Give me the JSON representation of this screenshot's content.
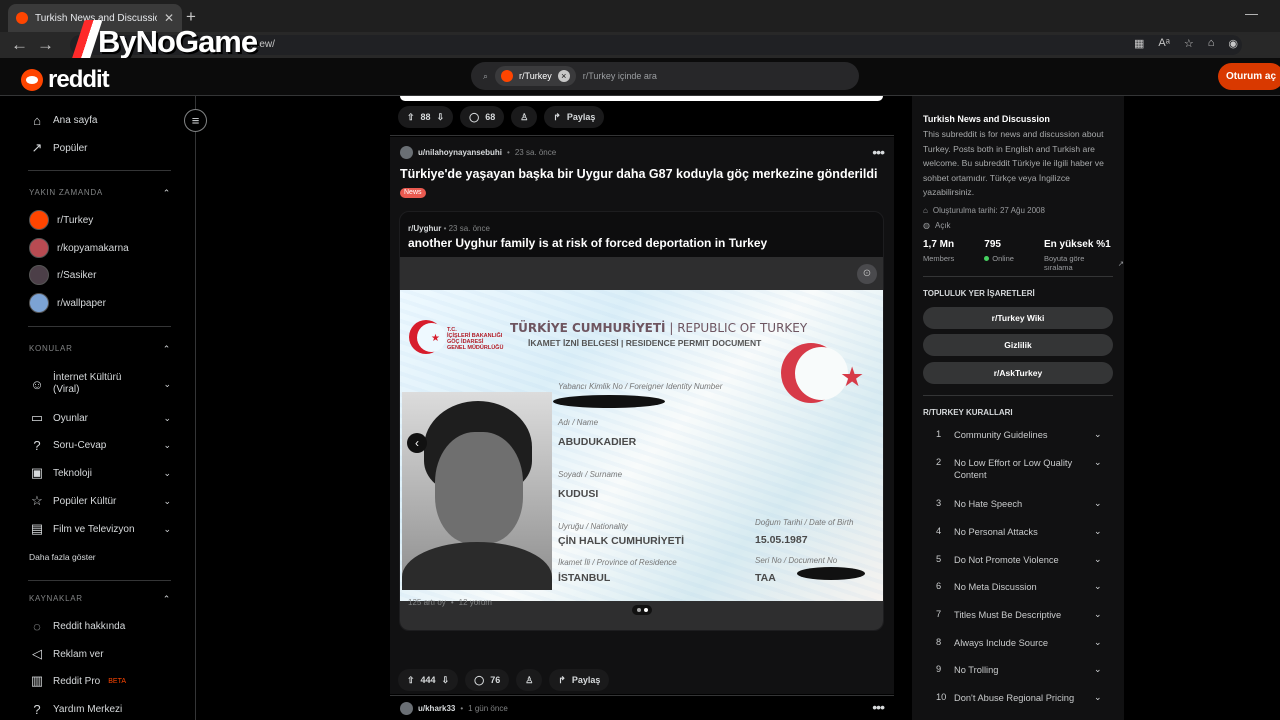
{
  "browser": {
    "tab_title": "Turkish News and Discussion",
    "address_text": "/new/",
    "watermark": "ByNoGame"
  },
  "header": {
    "logo_text": "reddit",
    "search_chip": "r/Turkey",
    "search_placeholder": "r/Turkey içinde ara",
    "login_label": "Oturum aç"
  },
  "sidebar": {
    "nav": [
      {
        "label": "Ana sayfa",
        "icon": "home-icon"
      },
      {
        "label": "Popüler",
        "icon": "popular-icon"
      }
    ],
    "recent_title": "YAKIN ZAMANDA",
    "recent": [
      {
        "label": "r/Turkey",
        "color": "#ff4500"
      },
      {
        "label": "r/kopyamakarna",
        "color": "#b84b52"
      },
      {
        "label": "r/Sasiker",
        "color": "#4c3f48"
      },
      {
        "label": "r/wallpaper",
        "color": "#7ca3d4"
      }
    ],
    "topics_title": "KONULAR",
    "topics": [
      {
        "label": "İnternet Kültürü (Viral)",
        "icon": "smile-icon"
      },
      {
        "label": "Oyunlar",
        "icon": "gamepad-icon"
      },
      {
        "label": "Soru-Cevap",
        "icon": "question-icon"
      },
      {
        "label": "Teknoloji",
        "icon": "chip-icon"
      },
      {
        "label": "Popüler Kültür",
        "icon": "star-icon"
      },
      {
        "label": "Film ve Televizyon",
        "icon": "film-icon"
      }
    ],
    "show_more": "Daha fazla göster",
    "resources_title": "KAYNAKLAR",
    "resources": [
      {
        "label": "Reddit hakkında",
        "icon": "reddit-icon"
      },
      {
        "label": "Reklam ver",
        "icon": "megaphone-icon"
      },
      {
        "label": "Reddit Pro",
        "icon": "chart-icon",
        "badge": "BETA"
      },
      {
        "label": "Yardım Merkezi",
        "icon": "help-icon"
      }
    ]
  },
  "feed": {
    "top_actions": {
      "upvotes": "88",
      "comments": "68",
      "share": "Paylaş"
    },
    "post": {
      "author": "u/nilahoynayansebuhi",
      "time": "23 sa. önce",
      "title": "Türkiye'de yaşayan başka bir Uygur daha G87 koduyla göç merkezine gönderildi",
      "flair": "News",
      "crosspost": {
        "subreddit": "r/Uyghur",
        "time": "23 sa. önce",
        "title": "another Uyghur family is at risk of forced deportation in Turkey",
        "stats_points": "125 artı oy",
        "stats_comments": "12 yorum",
        "document": {
          "ministry": [
            "T.C.",
            "İÇİŞLERİ BAKANLIĞI",
            "GÖÇ İDARESİ",
            "GENEL MÜDÜRLÜĞÜ"
          ],
          "heading_tr": "TÜRKİYE CUMHURİYETİ",
          "heading_en": "REPUBLIC OF TURKEY",
          "subheading": "İKAMET İZNİ BELGESİ | RESIDENCE PERMIT DOCUMENT",
          "fields": {
            "foreign_id_label": "Yabancı Kimlik No / Foreigner Identity Number",
            "name_label": "Adı / Name",
            "name": "ABUDUKADIER",
            "surname_label": "Soyadı / Surname",
            "surname": "KUDUSI",
            "nationality_label": "Uyruğu / Nationality",
            "nationality": "ÇİN HALK CUMHURİYETİ",
            "residence_label": "İkamet İli / Province of Residence",
            "residence": "İSTANBUL",
            "birth_label": "Doğum Tarihi / Date of Birth",
            "birth_date": "15.05.1987",
            "serial_label": "Seri No / Document No",
            "serial_prefix": "TAA"
          }
        }
      },
      "actions": {
        "upvotes": "444",
        "comments": "76",
        "share": "Paylaş"
      }
    },
    "next_post": {
      "author": "u/khark33",
      "time": "1 gün önce"
    }
  },
  "community": {
    "title": "Turkish News and Discussion",
    "description": "This subreddit is for news and discussion about Turkey. Posts both in English and Turkish are welcome. Bu subreddit Türkiye ile ilgili haber ve sohbet ortamıdır. Türkçe veya İngilizce yazabilirsiniz.",
    "created": "Oluşturulma tarihi: 27 Ağu 2008",
    "visibility": "Açık",
    "members_value": "1,7 Mn",
    "members_label": "Members",
    "online_value": "795",
    "online_label": "Online",
    "rank_value": "En yüksek %1",
    "rank_label": "Boyuta göre sıralama",
    "bookmarks_title": "TOPLULUK YER İŞARETLERİ",
    "bookmarks": [
      "r/Turkey Wiki",
      "Gizlilik",
      "r/AskTurkey"
    ],
    "rules_title": "R/TURKEY KURALLARI",
    "rules": [
      {
        "number": "1",
        "label": "Community Guidelines"
      },
      {
        "number": "2",
        "label": "No Low Effort or Low Quality Content"
      },
      {
        "number": "3",
        "label": "No Hate Speech"
      },
      {
        "number": "4",
        "label": "No Personal Attacks"
      },
      {
        "number": "5",
        "label": "Do Not Promote Violence"
      },
      {
        "number": "6",
        "label": "No Meta Discussion"
      },
      {
        "number": "7",
        "label": "Titles Must Be Descriptive"
      },
      {
        "number": "8",
        "label": "Always Include Source"
      },
      {
        "number": "9",
        "label": "No Trolling"
      },
      {
        "number": "10",
        "label": "Don't Abuse Regional Pricing"
      }
    ]
  }
}
